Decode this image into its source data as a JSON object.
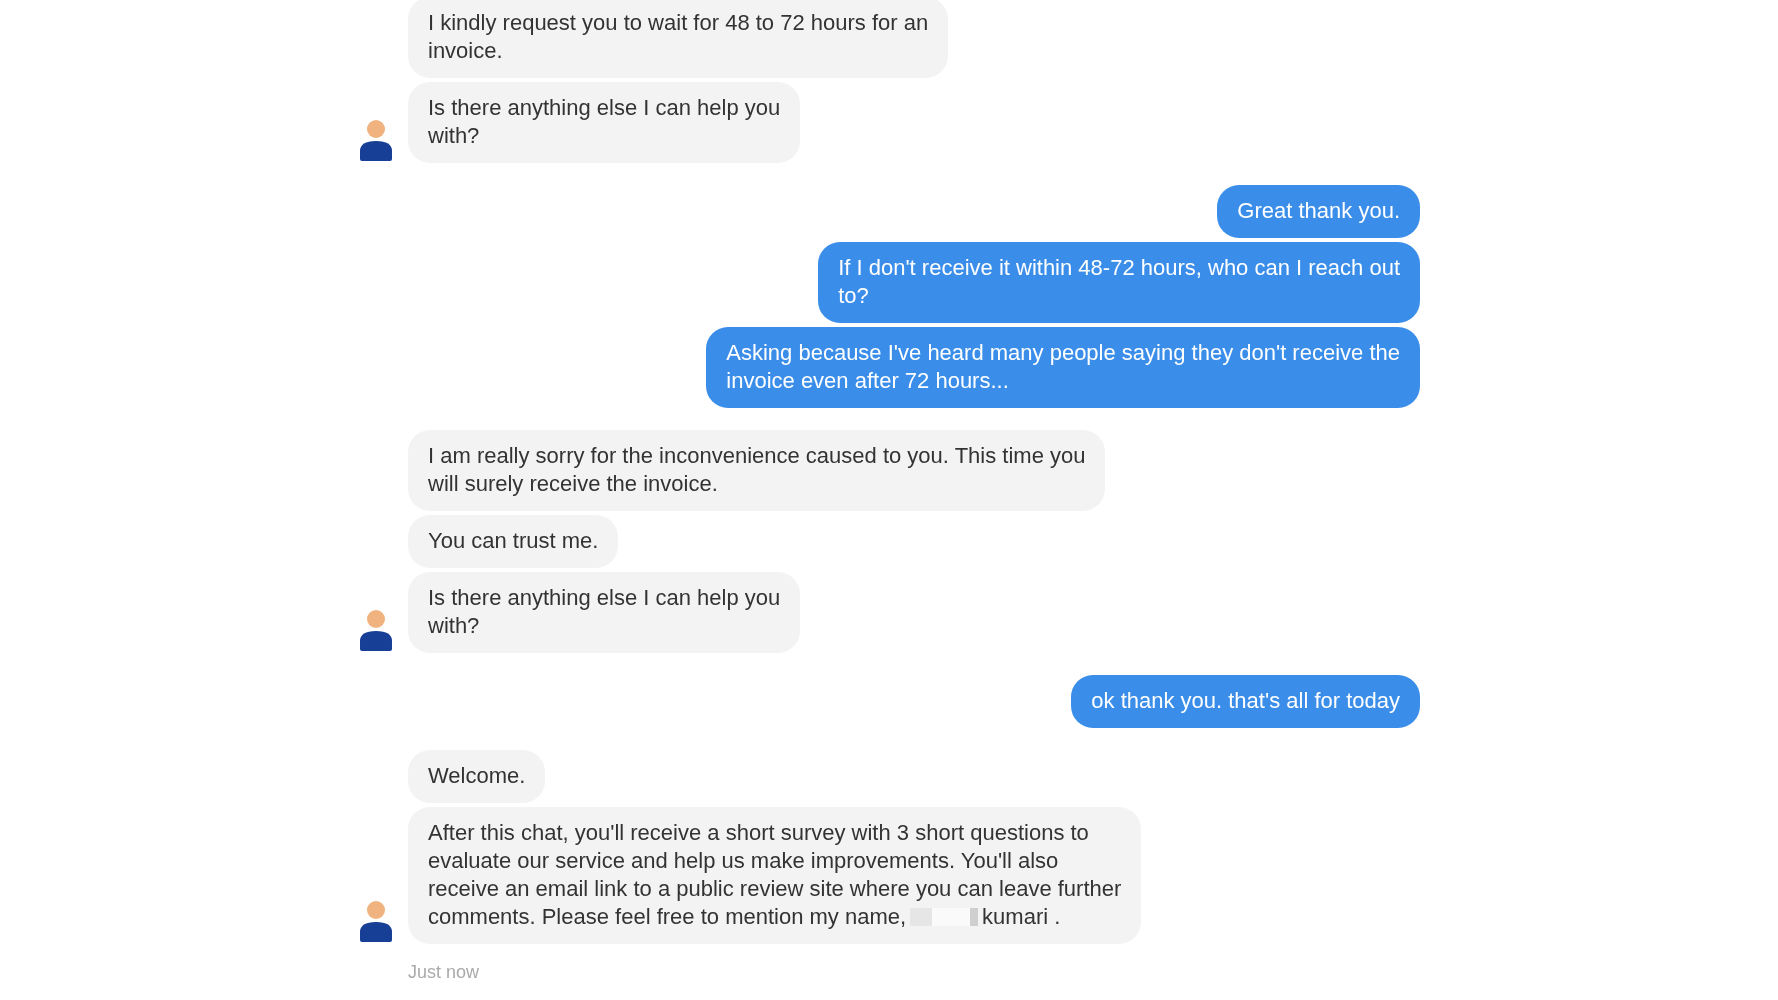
{
  "groups": [
    {
      "kind": "received",
      "messages": [
        {
          "lines": [
            "I kindly request you to wait for 48 to 72 hours for an",
            "invoice."
          ]
        },
        {
          "lines": [
            "Is there anything else I can help you",
            "with?"
          ]
        }
      ]
    },
    {
      "kind": "sent",
      "messages": [
        {
          "lines": [
            "Great thank you."
          ]
        },
        {
          "lines": [
            "If I don't receive it within 48-72 hours, who can I reach out",
            "to?"
          ]
        },
        {
          "lines": [
            "Asking because I've heard many people saying they don't receive the",
            "invoice even after 72 hours..."
          ]
        }
      ]
    },
    {
      "kind": "received",
      "messages": [
        {
          "lines": [
            "I am really sorry for the inconvenience caused to you. This time you",
            "will surely receive the invoice."
          ]
        },
        {
          "lines": [
            "You can trust me."
          ]
        },
        {
          "lines": [
            "Is there anything else I can help you",
            "with?"
          ]
        }
      ]
    },
    {
      "kind": "sent",
      "messages": [
        {
          "lines": [
            "ok thank you. that's all for today"
          ]
        }
      ]
    },
    {
      "kind": "received",
      "messages": [
        {
          "lines": [
            "Welcome."
          ]
        },
        {
          "lines": [
            "After this chat, you'll receive a short survey with 3 short questions to",
            "evaluate our service and help us make improvements. You'll also",
            "receive an email link to a public review site where you can leave further",
            "comments. Please feel free to mention my name,"
          ],
          "redacted": true,
          "text_after": "kumari ."
        }
      ]
    }
  ],
  "timestamp": "Just now"
}
